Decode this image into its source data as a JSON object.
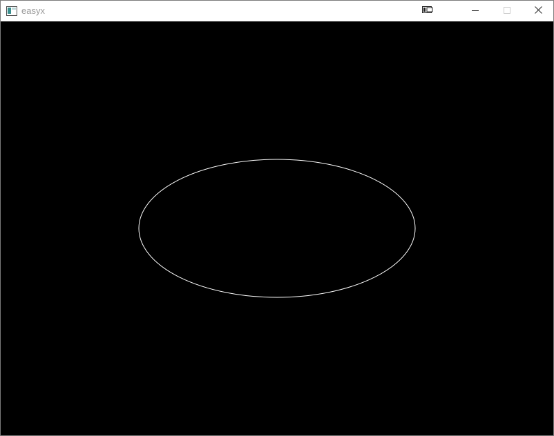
{
  "window": {
    "title": "easyx",
    "app_icon": "app-window-icon",
    "controls": {
      "extra": "snap-icon",
      "minimize": "minimize-icon",
      "maximize": "maximize-icon",
      "close": "close-icon"
    }
  },
  "canvas": {
    "background": "#000000",
    "shapes": [
      {
        "type": "ellipse",
        "stroke": "#ffffff",
        "fill": "none"
      }
    ]
  }
}
